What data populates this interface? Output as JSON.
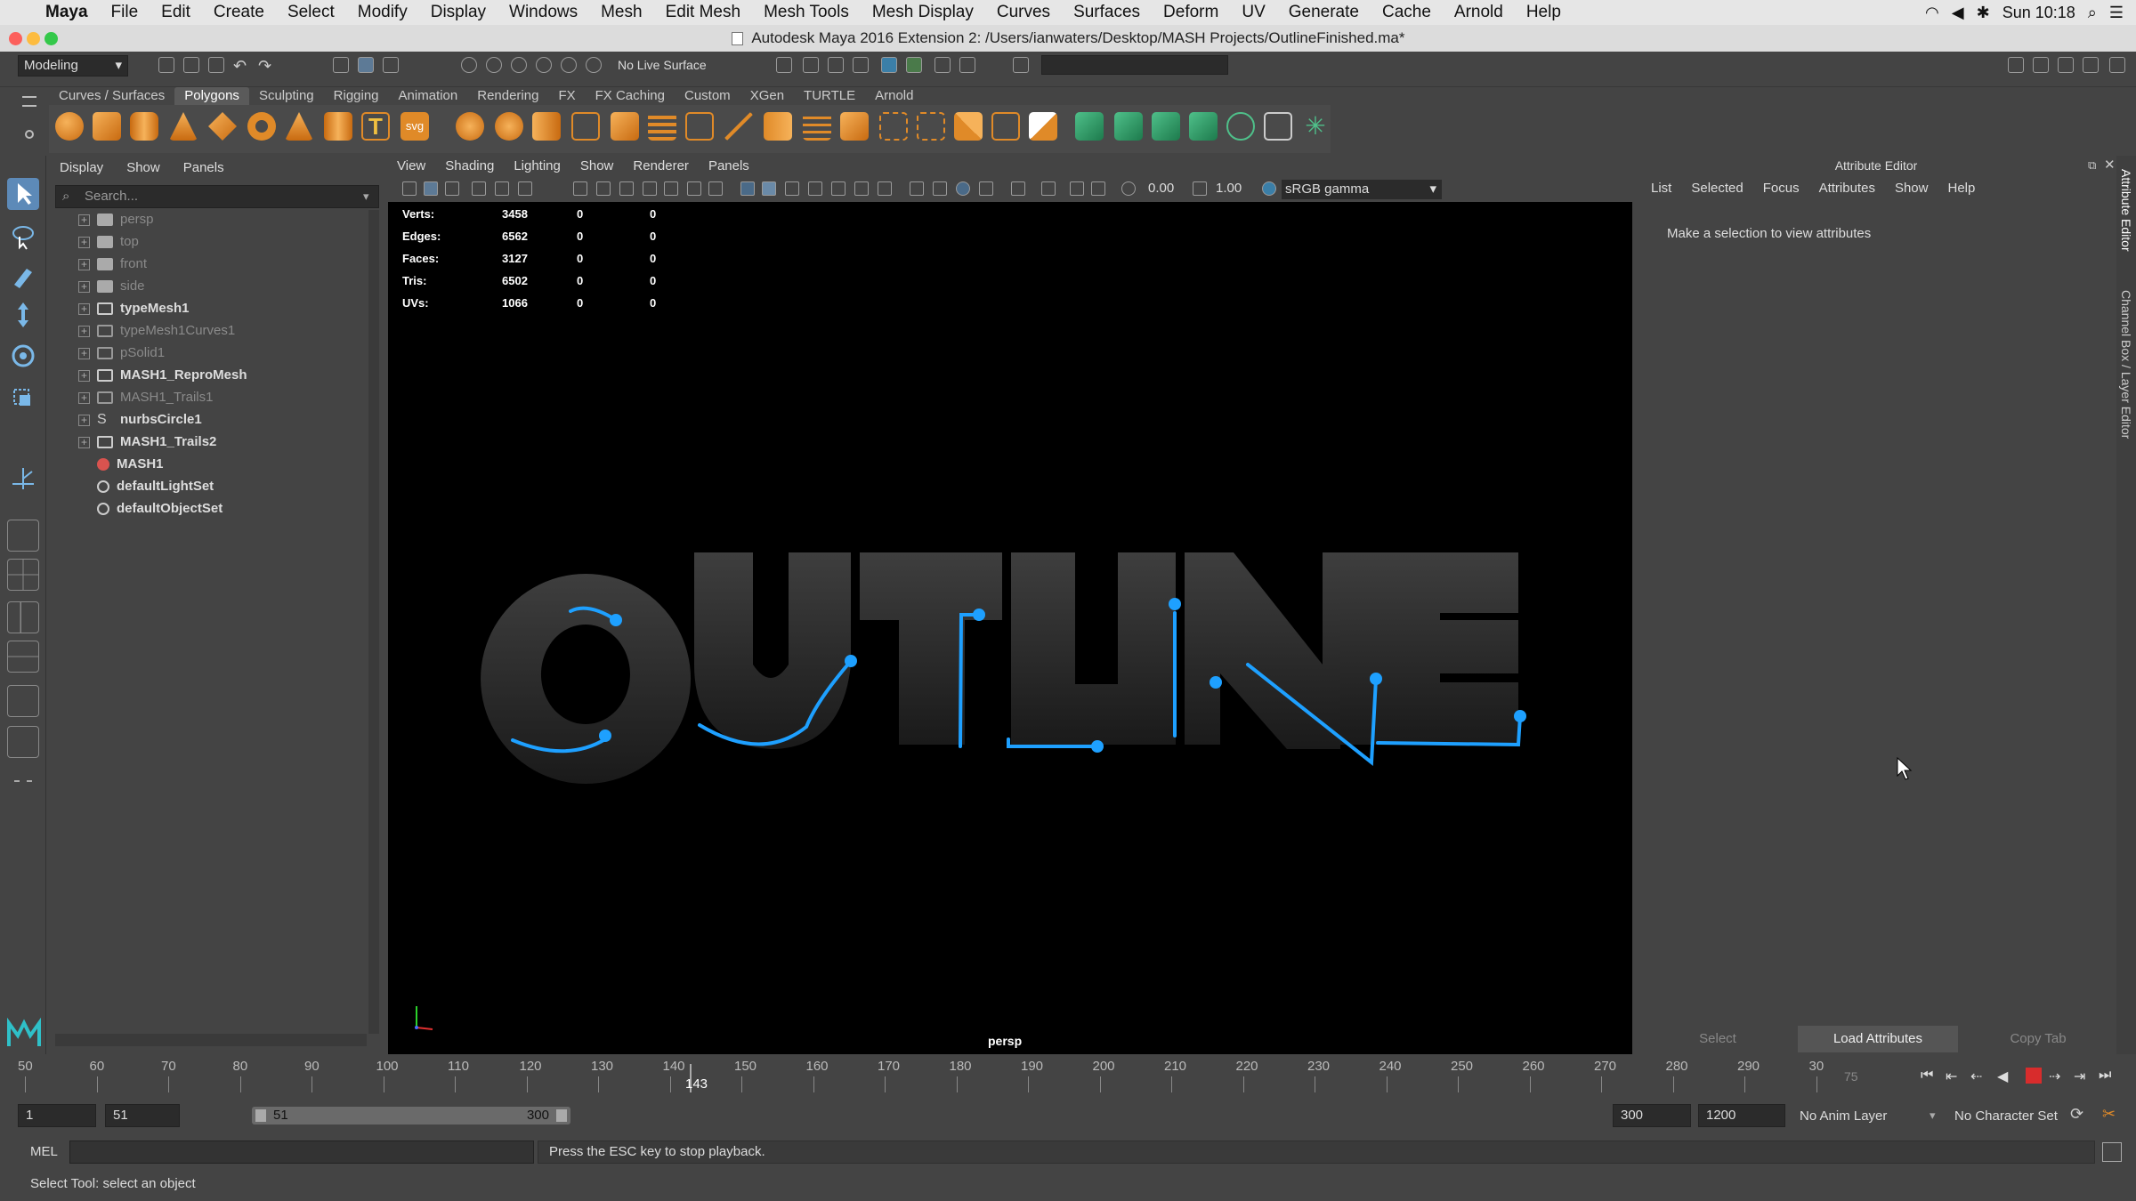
{
  "menubar": {
    "app": "Maya",
    "items": [
      "File",
      "Edit",
      "Create",
      "Select",
      "Modify",
      "Display",
      "Windows",
      "Mesh",
      "Edit Mesh",
      "Mesh Tools",
      "Mesh Display",
      "Curves",
      "Surfaces",
      "Deform",
      "UV",
      "Generate",
      "Cache",
      "Arnold",
      "Help"
    ],
    "clock": "Sun 10:18"
  },
  "window": {
    "title": "Autodesk Maya 2016 Extension 2: /Users/ianwaters/Desktop/MASH Projects/OutlineFinished.ma*"
  },
  "statusline": {
    "mode": "Modeling",
    "live_surface": "No Live Surface"
  },
  "shelf": {
    "tabs": [
      "Curves / Surfaces",
      "Polygons",
      "Sculpting",
      "Rigging",
      "Animation",
      "Rendering",
      "FX",
      "FX Caching",
      "Custom",
      "XGen",
      "TURTLE",
      "Arnold"
    ],
    "active_tab": "Polygons",
    "text_icon": "T",
    "svg_icon": "svg"
  },
  "outliner": {
    "menu": [
      "Display",
      "Show",
      "Panels"
    ],
    "search_placeholder": "Search...",
    "items": [
      {
        "label": "persp",
        "dim": true,
        "icon": "camera-icon",
        "expand": true
      },
      {
        "label": "top",
        "dim": true,
        "icon": "camera-icon",
        "expand": true
      },
      {
        "label": "front",
        "dim": true,
        "icon": "camera-icon",
        "expand": true
      },
      {
        "label": "side",
        "dim": true,
        "icon": "camera-icon",
        "expand": true
      },
      {
        "label": "typeMesh1",
        "dim": false,
        "icon": "transform-icon",
        "expand": true
      },
      {
        "label": "typeMesh1Curves1",
        "dim": true,
        "icon": "transform-icon",
        "expand": true
      },
      {
        "label": "pSolid1",
        "dim": true,
        "icon": "transform-icon",
        "expand": true
      },
      {
        "label": "MASH1_ReproMesh",
        "dim": false,
        "icon": "transform-icon",
        "expand": true
      },
      {
        "label": "MASH1_Trails1",
        "dim": true,
        "icon": "curve-icon",
        "expand": true
      },
      {
        "label": "nurbsCircle1",
        "dim": false,
        "icon": "nurbs-curve-icon",
        "expand": true
      },
      {
        "label": "MASH1_Trails2",
        "dim": false,
        "icon": "transform-icon",
        "expand": true
      },
      {
        "label": "MASH1",
        "dim": false,
        "icon": "mash-icon",
        "expand": false
      },
      {
        "label": "defaultLightSet",
        "dim": false,
        "icon": "set-icon",
        "expand": false
      },
      {
        "label": "defaultObjectSet",
        "dim": false,
        "icon": "set-icon",
        "expand": false
      }
    ]
  },
  "viewport": {
    "menu": [
      "View",
      "Shading",
      "Lighting",
      "Show",
      "Renderer",
      "Panels"
    ],
    "exposure": "0.00",
    "gamma": "1.00",
    "color_space": "sRGB gamma",
    "camera": "persp",
    "hud": [
      {
        "label": "Verts:",
        "values": [
          "3458",
          "0",
          "0"
        ]
      },
      {
        "label": "Edges:",
        "values": [
          "6562",
          "0",
          "0"
        ]
      },
      {
        "label": "Faces:",
        "values": [
          "3127",
          "0",
          "0"
        ]
      },
      {
        "label": "Tris:",
        "values": [
          "6502",
          "0",
          "0"
        ]
      },
      {
        "label": "UVs:",
        "values": [
          "1066",
          "0",
          "0"
        ]
      }
    ],
    "scene_text": "OUTLINE",
    "accent": "#1ea0ff"
  },
  "attribute_editor": {
    "title": "Attribute Editor",
    "menu": [
      "List",
      "Selected",
      "Focus",
      "Attributes",
      "Show",
      "Help"
    ],
    "message": "Make a selection to view attributes",
    "buttons": [
      "Select",
      "Load Attributes",
      "Copy Tab"
    ],
    "side_tabs": [
      "Attribute Editor",
      "Channel Box / Layer Editor"
    ]
  },
  "timeslider": {
    "ticks": [
      "50",
      "60",
      "70",
      "80",
      "90",
      "100",
      "110",
      "120",
      "130",
      "140",
      "150",
      "160",
      "170",
      "180",
      "190",
      "200",
      "210",
      "220",
      "230",
      "240",
      "250",
      "260",
      "270",
      "280",
      "290",
      "30"
    ],
    "current_frame": "143",
    "end_marker": "75"
  },
  "range": {
    "start": "1",
    "playback_start": "51",
    "range_start": "51",
    "range_end": "300",
    "playback_end": "300",
    "end": "1200",
    "anim_layer": "No Anim Layer",
    "character_set": "No Character Set"
  },
  "command_line": {
    "label": "MEL",
    "result": "Press the ESC key to stop playback."
  },
  "help_line": "Select Tool: select an object"
}
